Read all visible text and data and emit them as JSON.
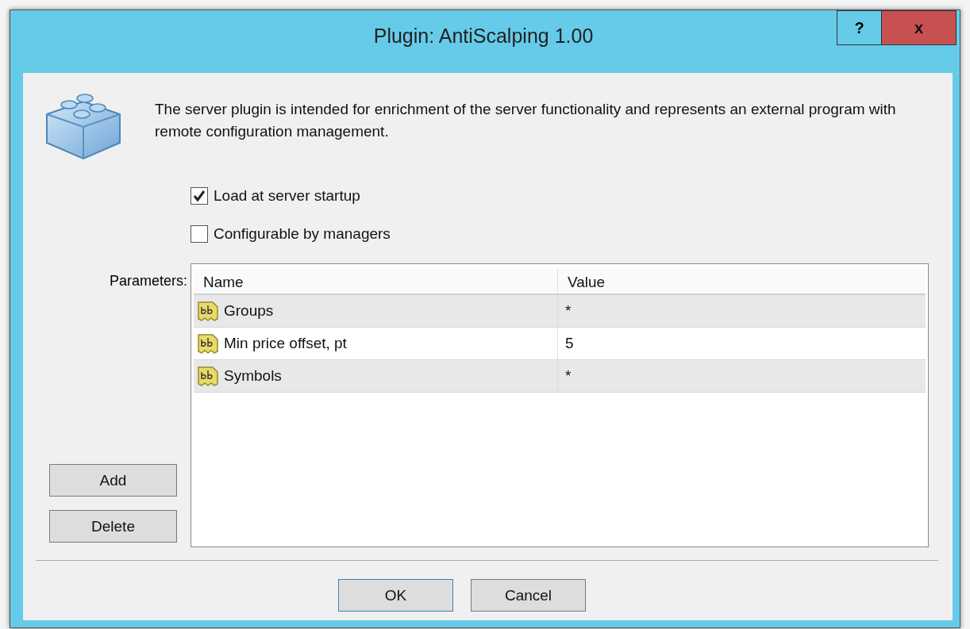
{
  "window": {
    "title": "Plugin: AntiScalping 1.00",
    "help_button": "?",
    "close_button": "x"
  },
  "description": "The server plugin is intended for enrichment of the server functionality and represents an external program with remote configuration management.",
  "options": [
    {
      "label": "Load at server startup",
      "checked": true
    },
    {
      "label": "Configurable by managers",
      "checked": false
    }
  ],
  "parameters": {
    "label": "Parameters:",
    "columns": [
      "Name",
      "Value"
    ],
    "rows": [
      {
        "name": "Groups",
        "value": "*"
      },
      {
        "name": "Min price offset, pt",
        "value": "5"
      },
      {
        "name": "Symbols",
        "value": "*"
      }
    ]
  },
  "side_buttons": [
    "Add",
    "Delete"
  ],
  "buttons": [
    {
      "label": "OK",
      "selected": true
    },
    {
      "label": "Cancel",
      "selected": false
    }
  ]
}
